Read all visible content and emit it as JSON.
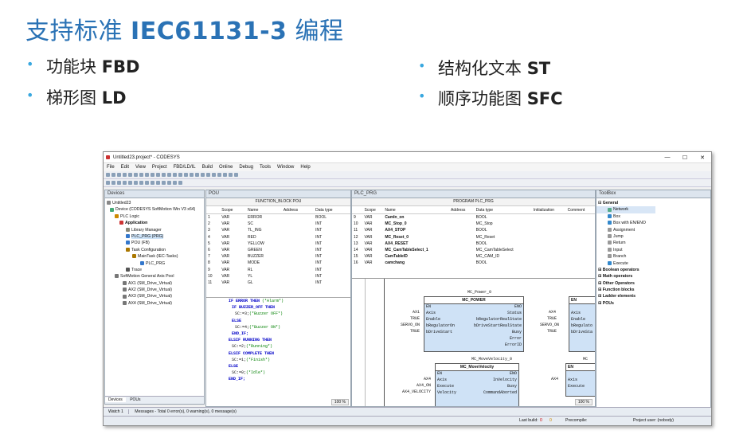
{
  "slide": {
    "title_prefix": "支持标准 ",
    "title_bold": "IEC61131-3",
    "title_suffix": " 编程",
    "bullets": [
      {
        "dot": "•",
        "prefix": "功能块 ",
        "bold": "FBD"
      },
      {
        "dot": "•",
        "prefix": "梯形图 ",
        "bold": "LD"
      },
      {
        "dot": "•",
        "prefix": "结构化文本 ",
        "bold": "ST"
      },
      {
        "dot": "•",
        "prefix": "顺序功能图 ",
        "bold": "SFC"
      }
    ]
  },
  "window": {
    "title": "Untitled23.project* - CODESYS",
    "controls": [
      "—",
      "☐",
      "✕"
    ],
    "menu": [
      "File",
      "Edit",
      "View",
      "Project",
      "FBD/LD/IL",
      "Build",
      "Online",
      "Debug",
      "Tools",
      "Window",
      "Help"
    ]
  },
  "devices": {
    "header": "Devices",
    "tree": [
      {
        "label": "Untitled23",
        "color": "#888"
      },
      {
        "label": "Device (CODESYS SoftMotion Win V3 x64)",
        "color": "#4a7"
      },
      {
        "label": "PLC Logic",
        "color": "#c80"
      },
      {
        "label": "Application",
        "color": "#c33"
      },
      {
        "label": "Library Manager",
        "color": "#887"
      },
      {
        "label": "PLC_PRG (PRG)",
        "color": "#37c"
      },
      {
        "label": "POU (FB)",
        "color": "#37c"
      },
      {
        "label": "Task Configuration",
        "color": "#a70"
      },
      {
        "label": "MainTask (IEC-Tasks)",
        "color": "#a70"
      },
      {
        "label": "PLC_PRG",
        "color": "#37c"
      },
      {
        "label": "Trace",
        "color": "#555"
      },
      {
        "label": "SoftMotion General Axis Pool",
        "color": "#777"
      },
      {
        "label": "AX1 (SM_Drive_Virtual)",
        "color": "#777"
      },
      {
        "label": "AX2 (SM_Drive_Virtual)",
        "color": "#777"
      },
      {
        "label": "AX3 (SM_Drive_Virtual)",
        "color": "#777"
      },
      {
        "label": "AX4 (SM_Drive_Virtual)",
        "color": "#777"
      }
    ],
    "tabs": [
      "Devices",
      "POUs"
    ]
  },
  "pou_editor": {
    "tab": "POU",
    "header": "FUNCTION_BLOCK POU",
    "columns": [
      "Scope",
      "Name",
      "Address",
      "Data type"
    ],
    "rows": [
      {
        "n": "1",
        "scope": "VAR",
        "name": "ERROR",
        "type": "BOOL"
      },
      {
        "n": "2",
        "scope": "VAR",
        "name": "SC",
        "type": "INT"
      },
      {
        "n": "3",
        "scope": "VAR",
        "name": "TL_ING",
        "type": "INT"
      },
      {
        "n": "4",
        "scope": "VAR",
        "name": "RED",
        "type": "INT"
      },
      {
        "n": "5",
        "scope": "VAR",
        "name": "YELLOW",
        "type": "INT"
      },
      {
        "n": "6",
        "scope": "VAR",
        "name": "GREEN",
        "type": "INT"
      },
      {
        "n": "7",
        "scope": "VAR",
        "name": "BUZZER",
        "type": "INT"
      },
      {
        "n": "8",
        "scope": "VAR",
        "name": "MODE",
        "type": "INT"
      },
      {
        "n": "9",
        "scope": "VAR",
        "name": "RL",
        "type": "INT"
      },
      {
        "n": "10",
        "scope": "VAR",
        "name": "YL",
        "type": "INT"
      },
      {
        "n": "11",
        "scope": "VAR",
        "name": "GL",
        "type": "INT"
      }
    ],
    "code": [
      {
        "kw1": "IF ERROR THEN ",
        "txt": "",
        "cm": "(*Alarm*)"
      },
      {
        "kw1": "IF BUZZER_OFF THEN",
        "txt": "",
        "cm": ""
      },
      {
        "kw1": "",
        "txt": "SC:=3;",
        "cm": "(*Buzzer OFF*)"
      },
      {
        "kw1": "ELSE",
        "txt": "",
        "cm": ""
      },
      {
        "kw1": "",
        "txt": "SC:=4;",
        "cm": "(*Buzzer ON*)"
      },
      {
        "kw1": "END_IF;",
        "txt": "",
        "cm": ""
      },
      {
        "kw1": "ELSIF RUNNING THEN",
        "txt": "",
        "cm": ""
      },
      {
        "kw1": "",
        "txt": "SC:=2;",
        "cm": "(*Running*)"
      },
      {
        "kw1": "ELSIF COMPLETE THEN",
        "txt": "",
        "cm": ""
      },
      {
        "kw1": "",
        "txt": "SC:=1;",
        "cm": "(*Finish*)"
      },
      {
        "kw1": "ELSE",
        "txt": "",
        "cm": ""
      },
      {
        "kw1": "",
        "txt": "SC:=0;",
        "cm": "(*Idle*)"
      },
      {
        "kw1": "END_IF;",
        "txt": "",
        "cm": ""
      }
    ],
    "zoom": "100 %"
  },
  "prg_editor": {
    "tab": "PLC_PRG",
    "header": "PROGRAM PLC_PRG",
    "columns": [
      "Scope",
      "Name",
      "Address",
      "Data type",
      "Initialization",
      "Comment"
    ],
    "rows": [
      {
        "n": "9",
        "scope": "VAR",
        "name": "CamIn_on",
        "type": "BOOL"
      },
      {
        "n": "10",
        "scope": "VAR",
        "name": "MC_Stop_0",
        "type": "MC_Stop"
      },
      {
        "n": "11",
        "scope": "VAR",
        "name": "AX4_STOP",
        "type": "BOOL"
      },
      {
        "n": "12",
        "scope": "VAR",
        "name": "MC_Reset_0",
        "type": "MC_Reset"
      },
      {
        "n": "13",
        "scope": "VAR",
        "name": "AX4_RESET",
        "type": "BOOL"
      },
      {
        "n": "14",
        "scope": "VAR",
        "name": "MC_CamTableSelect_1",
        "type": "MC_CamTableSelect"
      },
      {
        "n": "15",
        "scope": "VAR",
        "name": "CamTableID",
        "type": "MC_CAM_ID"
      },
      {
        "n": "16",
        "scope": "VAR",
        "name": "camchang",
        "type": "BOOL"
      }
    ],
    "block1": {
      "instance": "MC_Power_0",
      "type": "MC_POWER",
      "en": "EN",
      "eno": "ENO",
      "inputs": [
        {
          "var": "AX1",
          "pin": "Axis"
        },
        {
          "var": "TRUE",
          "pin": "Enable"
        },
        {
          "var": "SERVO_ON",
          "pin": "bRegulatorOn"
        },
        {
          "var": "TRUE",
          "pin": "bDriveStart"
        }
      ],
      "outputs": [
        "Status",
        "bRegulatorRealState",
        "bDriveStartRealState",
        "Busy",
        "Error",
        "ErrorID"
      ]
    },
    "block2": {
      "instance": "MC_MoveVelocity_0",
      "type": "MC_MoveVelocity",
      "en": "EN",
      "eno": "ENO",
      "inputs": [
        {
          "var": "AX4",
          "pin": "Axis"
        },
        {
          "var": "AX4_ON",
          "pin": "Execute"
        },
        {
          "var": "AX4_VELOCITY",
          "pin": "Velocity"
        }
      ],
      "outputs": [
        "InVelocity",
        "Busy",
        "CommandAborted"
      ]
    },
    "block3": {
      "inputs": [
        {
          "var": "AX4",
          "pin": "Axis"
        },
        {
          "var": "TRUE",
          "pin": "Enable"
        },
        {
          "var": "SERVO_ON",
          "pin": "bRegulato"
        },
        {
          "var": "TRUE",
          "pin": "bDriveSta"
        }
      ],
      "en": "EN"
    },
    "block4": {
      "label": "MC",
      "inputs": [
        {
          "var": "AX4",
          "pin": "Axis"
        },
        {
          "var": "",
          "pin": "Execute"
        }
      ],
      "en": "EN"
    },
    "zoom": "100 %"
  },
  "toolbox": {
    "header": "ToolBox",
    "sections": [
      {
        "label": "General",
        "expanded": true,
        "items": [
          "Network",
          "Box",
          "Box with EN/ENO",
          "Assignment",
          "Jump",
          "Return",
          "Input",
          "Branch",
          "Execute"
        ]
      },
      {
        "label": "Boolean operators",
        "expanded": false,
        "items": []
      },
      {
        "label": "Math operators",
        "expanded": false,
        "items": []
      },
      {
        "label": "Other Operators",
        "expanded": false,
        "items": []
      },
      {
        "label": "Function blocks",
        "expanded": false,
        "items": []
      },
      {
        "label": "Ladder elements",
        "expanded": false,
        "items": []
      },
      {
        "label": "POUs",
        "expanded": false,
        "items": []
      }
    ]
  },
  "statusbar": {
    "watch": "Watch 1",
    "messages": "Messages - Total 0 error(s), 0 warning(s), 0 message(s)",
    "last_build": "Last build:",
    "errors": "0",
    "warnings": "0",
    "precompile": "Precompile:",
    "project_user": "Project user: (nobody)"
  }
}
